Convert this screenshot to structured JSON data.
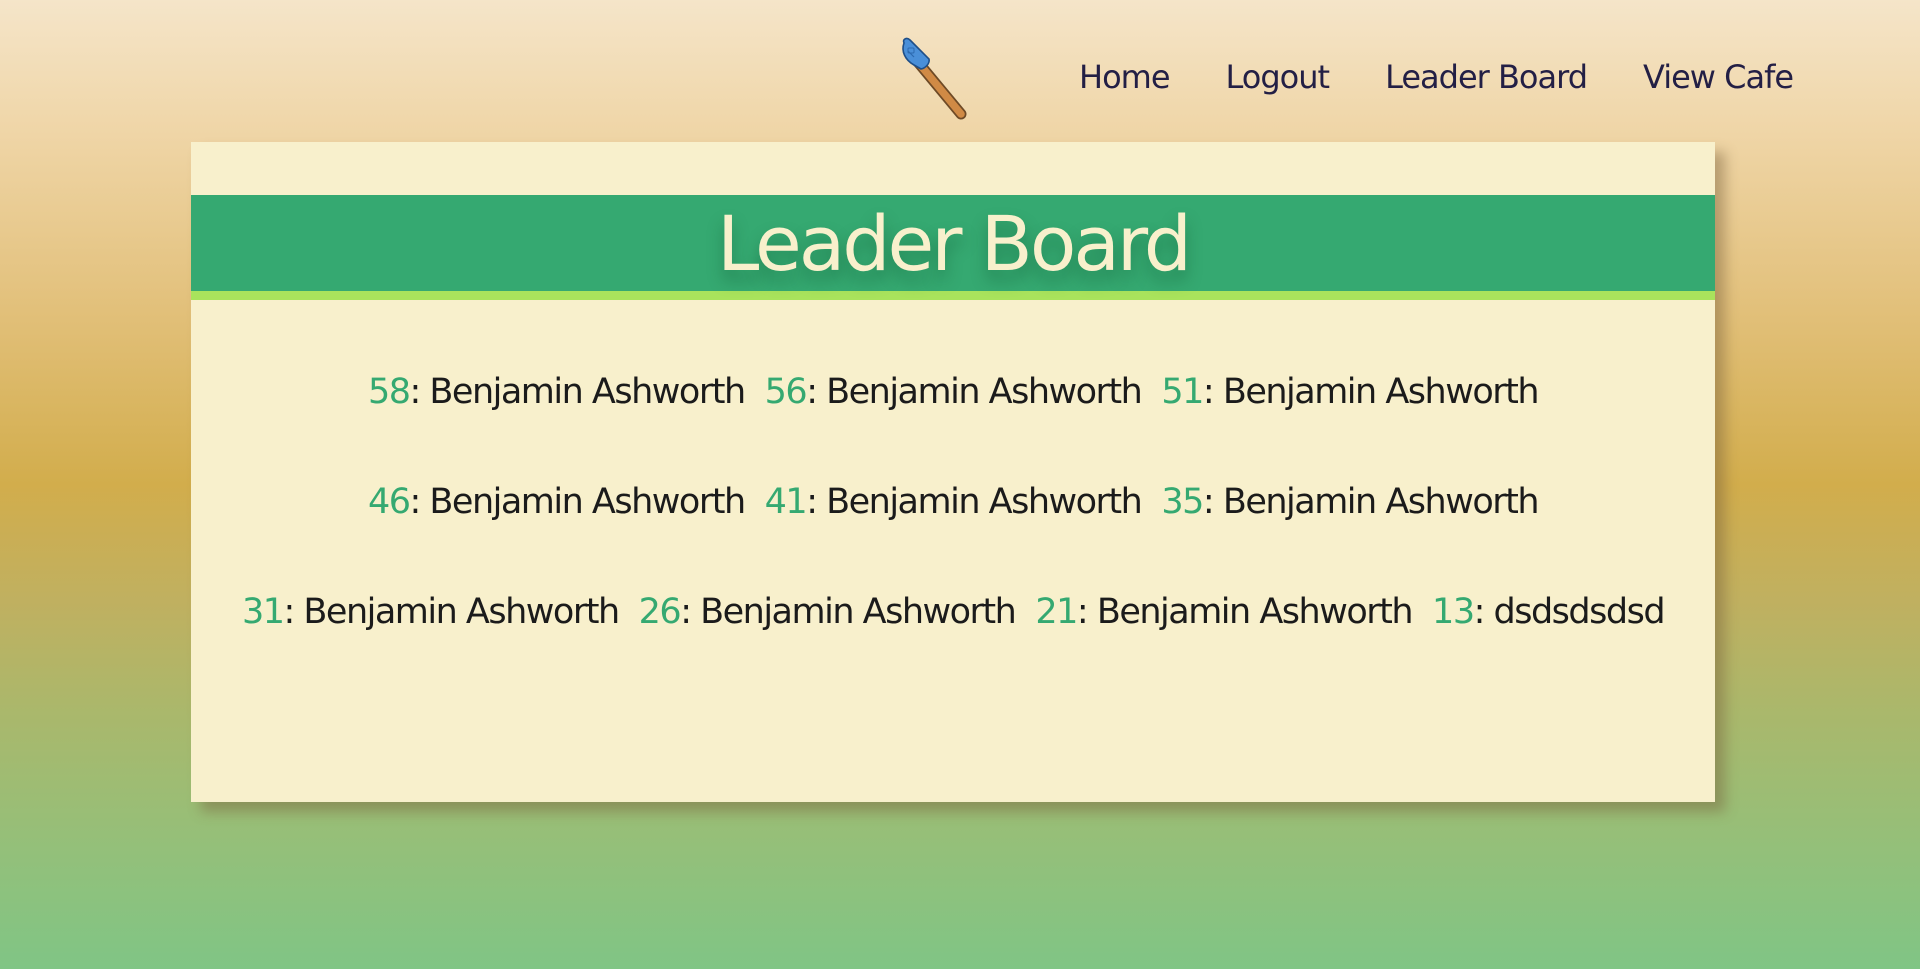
{
  "nav": {
    "logo_icon": "spatula-icon",
    "links": [
      "Home",
      "Logout",
      "Leader Board",
      "View Cafe"
    ]
  },
  "card": {
    "title": "Leader Board",
    "entries": [
      {
        "score": "58",
        "separator": ": ",
        "name": "Benjamin Ashworth"
      },
      {
        "score": "56",
        "separator": ": ",
        "name": "Benjamin Ashworth"
      },
      {
        "score": "51",
        "separator": ": ",
        "name": "Benjamin Ashworth"
      },
      {
        "score": "46",
        "separator": ": ",
        "name": "Benjamin Ashworth"
      },
      {
        "score": "41",
        "separator": ": ",
        "name": "Benjamin Ashworth"
      },
      {
        "score": "35",
        "separator": ": ",
        "name": "Benjamin Ashworth"
      },
      {
        "score": "31",
        "separator": ": ",
        "name": "Benjamin Ashworth"
      },
      {
        "score": "26",
        "separator": ": ",
        "name": "Benjamin Ashworth"
      },
      {
        "score": "21",
        "separator": ": ",
        "name": "Benjamin Ashworth"
      },
      {
        "score": "13",
        "separator": ": ",
        "name": "dsdsdsdsd"
      }
    ]
  },
  "colors": {
    "accent_green": "#35a971",
    "banner_underline": "#a9e35c",
    "card_background": "#f8f0cc",
    "nav_text": "#231f45"
  }
}
